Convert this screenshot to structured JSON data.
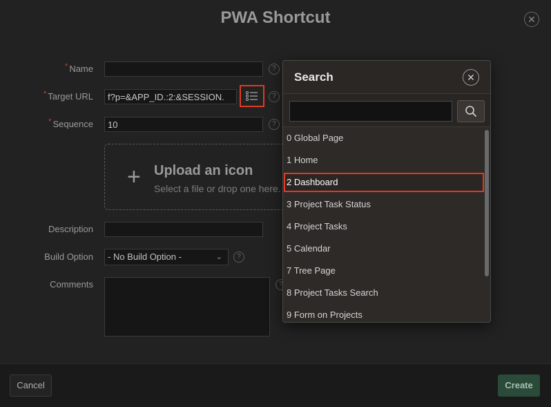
{
  "dialog": {
    "title": "PWA Shortcut",
    "close_icon": "close-icon"
  },
  "form": {
    "name_label": "Name",
    "name_value": "",
    "target_url_label": "Target URL",
    "target_url_value": "f?p=&APP_ID.:2:&SESSION.",
    "sequence_label": "Sequence",
    "sequence_value": "10",
    "upload_title": "Upload an icon",
    "upload_subtitle": "Select a file or drop one here.",
    "description_label": "Description",
    "description_value": "",
    "build_option_label": "Build Option",
    "build_option_value": "- No Build Option -",
    "comments_label": "Comments",
    "comments_value": "",
    "help_glyph": "?",
    "required_mark": "*"
  },
  "footer": {
    "cancel_label": "Cancel",
    "create_label": "Create"
  },
  "search_popup": {
    "title": "Search",
    "query": "",
    "items": [
      {
        "label": "0 Global Page"
      },
      {
        "label": "1 Home"
      },
      {
        "label": "2 Dashboard",
        "selected": true
      },
      {
        "label": "3 Project Task Status"
      },
      {
        "label": "4 Project Tasks"
      },
      {
        "label": "5 Calendar"
      },
      {
        "label": "7 Tree Page"
      },
      {
        "label": "8 Project Tasks Search"
      },
      {
        "label": "9 Form on Projects"
      }
    ]
  },
  "colors": {
    "highlight": "#e03b24",
    "create_button": "#2a4a3a",
    "background": "#222222"
  }
}
